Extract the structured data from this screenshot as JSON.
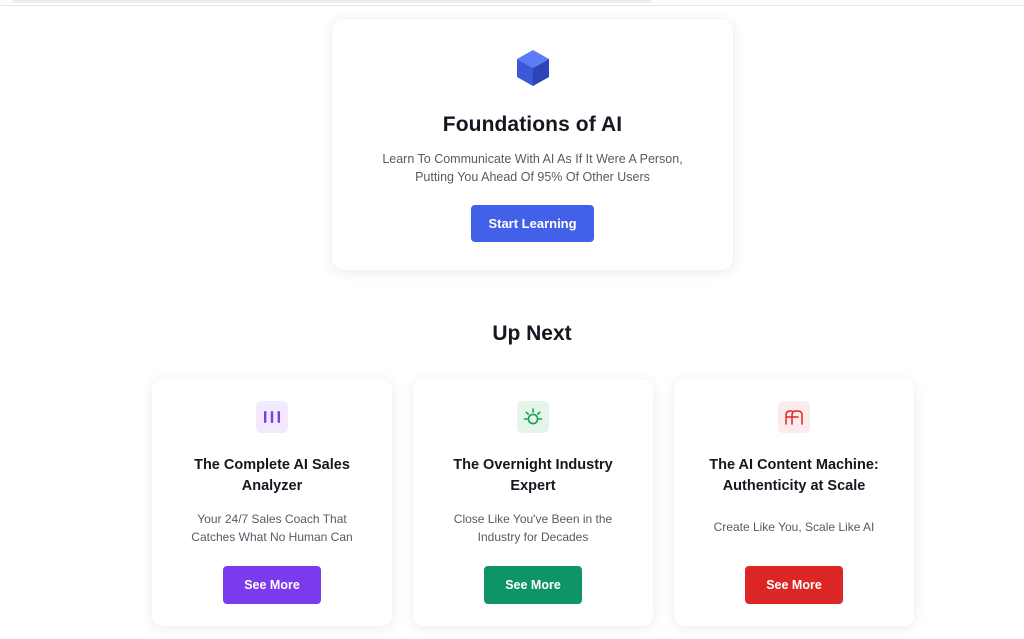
{
  "hero": {
    "icon": "cube-icon",
    "title": "Foundations of AI",
    "description_line1": "Learn To Communicate With AI As If It Were A Person,",
    "description_line2": "Putting You Ahead Of 95% Of Other Users",
    "button_label": "Start Learning",
    "accent": "#4261e8"
  },
  "up_next": {
    "heading": "Up Next",
    "cards": [
      {
        "icon": "bars-icon",
        "icon_color": "#7c3aed",
        "icon_bg": "#f1eafe",
        "title_line1": "The Complete AI Sales",
        "title_line2": "Analyzer",
        "desc_line1": "Your 24/7 Sales Coach That",
        "desc_line2": "Catches What No Human Can",
        "button_label": "See More",
        "button_color": "#7c3aed"
      },
      {
        "icon": "sun-icon",
        "icon_color": "#16a34a",
        "icon_bg": "#e6f5ec",
        "title_line1": "The Overnight Industry",
        "title_line2": "Expert",
        "desc_line1": "Close Like You've Been in the",
        "desc_line2": "Industry for Decades",
        "button_label": "See More",
        "button_color": "#0e9466"
      },
      {
        "icon": "ligature-icon",
        "icon_color": "#dc2626",
        "icon_bg": "#fdeaea",
        "title_line1": "The AI Content Machine:",
        "title_line2": "Authenticity at Scale",
        "desc_line1": "Create Like You, Scale Like AI",
        "button_label": "See More",
        "button_color": "#dc2626"
      }
    ]
  }
}
